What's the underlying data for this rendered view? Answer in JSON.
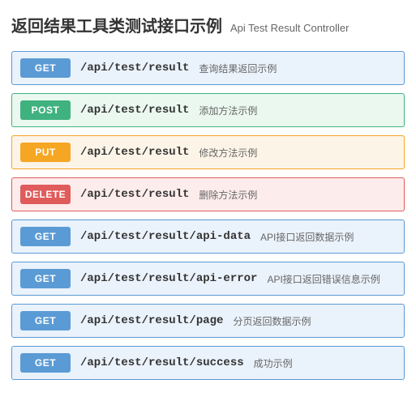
{
  "header": {
    "title": "返回结果工具类测试接口示例",
    "subtitle": "Api Test Result Controller"
  },
  "endpoints": [
    {
      "method": "GET",
      "path": "/api/test/result",
      "desc": "查询结果返回示例"
    },
    {
      "method": "POST",
      "path": "/api/test/result",
      "desc": "添加方法示例"
    },
    {
      "method": "PUT",
      "path": "/api/test/result",
      "desc": "修改方法示例"
    },
    {
      "method": "DELETE",
      "path": "/api/test/result",
      "desc": "删除方法示例"
    },
    {
      "method": "GET",
      "path": "/api/test/result/api-data",
      "desc": "API接口返回数据示例"
    },
    {
      "method": "GET",
      "path": "/api/test/result/api-error",
      "desc": "API接口返回错误信息示例"
    },
    {
      "method": "GET",
      "path": "/api/test/result/page",
      "desc": "分页返回数据示例"
    },
    {
      "method": "GET",
      "path": "/api/test/result/success",
      "desc": "成功示例"
    }
  ],
  "method_classes": {
    "GET": "m-get",
    "POST": "m-post",
    "PUT": "m-put",
    "DELETE": "m-delete"
  }
}
